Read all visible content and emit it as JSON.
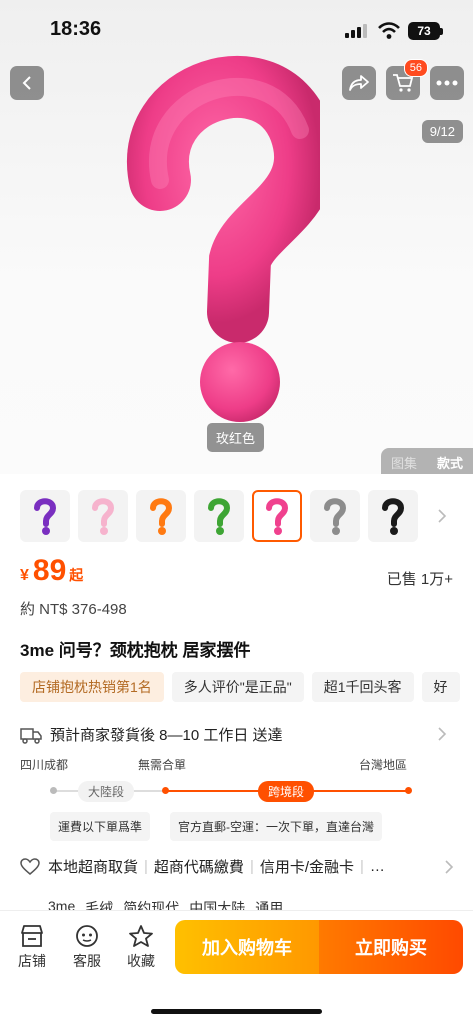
{
  "status_bar": {
    "time": "18:36",
    "battery": "73"
  },
  "header": {
    "cart_count": "56",
    "image_counter": "9/12"
  },
  "hero": {
    "color_label": "玫红色",
    "view_tabs": [
      "图集",
      "款式"
    ],
    "product_color": "#f0418e"
  },
  "thumbnails": [
    {
      "color": "#7a2fc0"
    },
    {
      "color": "#f6b3cd"
    },
    {
      "color": "#ff7a12"
    },
    {
      "color": "#3ea534"
    },
    {
      "color": "#f0418e",
      "selected": true
    },
    {
      "color": "#8c8c8c"
    },
    {
      "color": "#1a1a1a"
    }
  ],
  "price": {
    "currency": "¥",
    "amount": "89",
    "suffix": "起",
    "sold": "已售 1万+",
    "ntd": "約 NT$ 376-498"
  },
  "product": {
    "title": "3me 问号？颈枕抱枕 居家摆件"
  },
  "tags": [
    "店铺抱枕热销第1名",
    "多人评价\"是正品\"",
    "超1千回头客",
    "好"
  ],
  "shipping": {
    "estimate": "預計商家發貨後 8—10 工作日 送達",
    "origin": "四川成都",
    "middle": "無需合單",
    "dest": "台灣地區",
    "seg1": "大陸段",
    "seg2": "跨境段",
    "note1": "運費以下單爲準",
    "note2": "官方直郵-空運：一次下單，直達台灣"
  },
  "services": {
    "items": [
      "本地超商取貨",
      "超商代碼繳費",
      "信用卡/金融卡"
    ],
    "more": "…"
  },
  "params_row": [
    "3me",
    "毛绒",
    "简约现代",
    "中国大陆",
    "通用"
  ],
  "bottom_bar": {
    "shop": "店铺",
    "service": "客服",
    "favorite": "收藏",
    "add_to_cart": "加入购物车",
    "buy_now": "立即购买"
  },
  "colors": {
    "accent": "#ff5000",
    "selected_border": "#ff5a00"
  }
}
